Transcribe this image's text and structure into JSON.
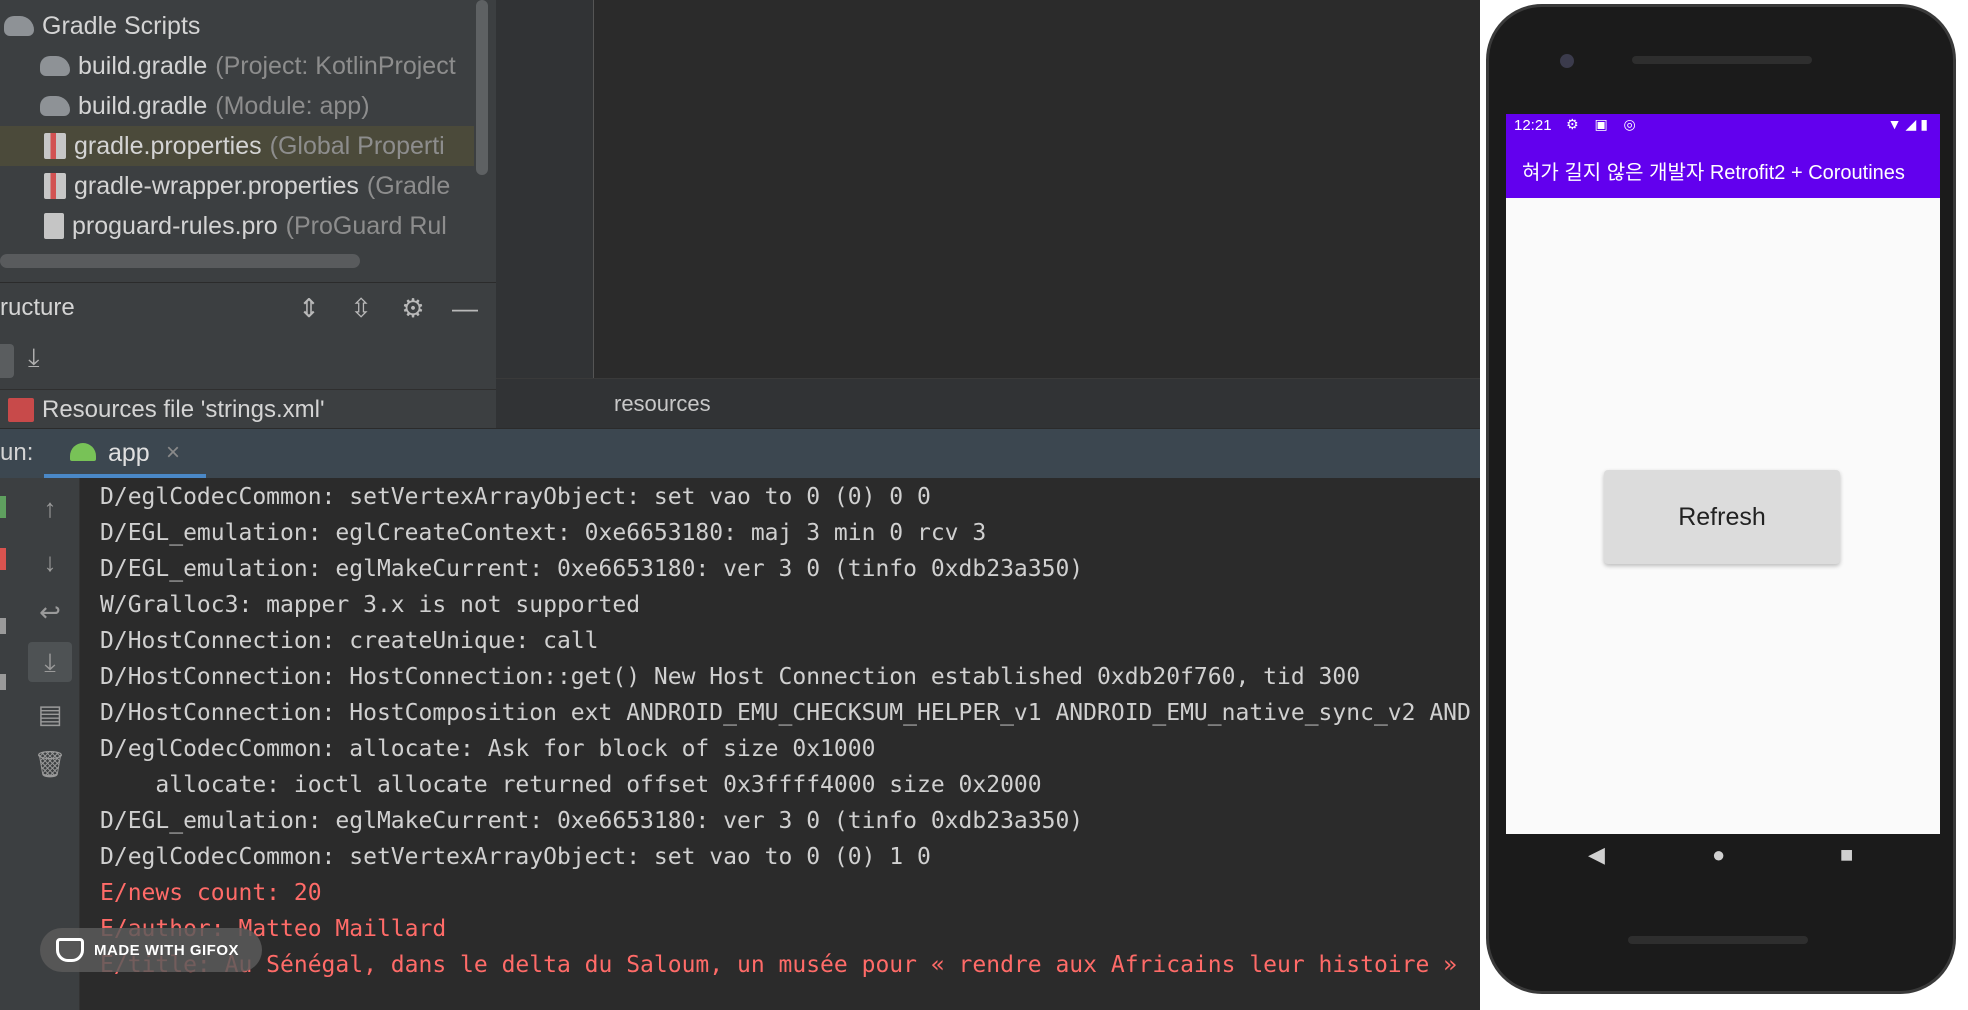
{
  "project_tree": {
    "items": [
      {
        "label": "Gradle Scripts",
        "hint": ""
      },
      {
        "label": "build.gradle",
        "hint": "(Project: KotlinProject"
      },
      {
        "label": "build.gradle",
        "hint": "(Module: app)"
      },
      {
        "label": "gradle.properties",
        "hint": "(Global Properti"
      },
      {
        "label": "gradle-wrapper.properties",
        "hint": "(Gradle"
      },
      {
        "label": "proguard-rules.pro",
        "hint": "(ProGuard Rul"
      }
    ]
  },
  "structure": {
    "title": "ructure",
    "item_label": "Resources file 'strings.xml'"
  },
  "editor": {
    "breadcrumb": "resources"
  },
  "run": {
    "label": "un:",
    "tab_label": "app",
    "close_glyph": "×"
  },
  "console": {
    "lines": [
      {
        "text": "D/eglCodecCommon: setVertexArrayObject: set vao to 0 (0) 0 0",
        "level": "debug"
      },
      {
        "text": "D/EGL_emulation: eglCreateContext: 0xe6653180: maj 3 min 0 rcv 3",
        "level": "debug"
      },
      {
        "text": "D/EGL_emulation: eglMakeCurrent: 0xe6653180: ver 3 0 (tinfo 0xdb23a350)",
        "level": "debug"
      },
      {
        "text": "W/Gralloc3: mapper 3.x is not supported",
        "level": "warn"
      },
      {
        "text": "D/HostConnection: createUnique: call",
        "level": "debug"
      },
      {
        "text": "D/HostConnection: HostConnection::get() New Host Connection established 0xdb20f760, tid 300",
        "level": "debug"
      },
      {
        "text": "D/HostConnection: HostComposition ext ANDROID_EMU_CHECKSUM_HELPER_v1 ANDROID_EMU_native_sync_v2 AND",
        "level": "debug"
      },
      {
        "text": "D/eglCodecCommon: allocate: Ask for block of size 0x1000",
        "level": "debug"
      },
      {
        "text": "    allocate: ioctl allocate returned offset 0x3ffff4000 size 0x2000",
        "level": "debug"
      },
      {
        "text": "D/EGL_emulation: eglMakeCurrent: 0xe6653180: ver 3 0 (tinfo 0xdb23a350)",
        "level": "debug"
      },
      {
        "text": "D/eglCodecCommon: setVertexArrayObject: set vao to 0 (0) 1 0",
        "level": "debug"
      },
      {
        "text": "E/news count: 20",
        "level": "error"
      },
      {
        "text": "E/author: Matteo Maillard",
        "level": "error"
      },
      {
        "text": "E/title: Au Sénégal, dans le delta du Saloum, un musée pour « rendre aux Africains leur histoire »",
        "level": "error"
      }
    ],
    "toolbar_icons": [
      "up-arrow-icon",
      "down-arrow-icon",
      "soft-wrap-icon",
      "scroll-to-end-icon",
      "print-icon",
      "trash-icon"
    ]
  },
  "badge": {
    "label": "MADE WITH GIFOX"
  },
  "phone": {
    "status_time": "12:21",
    "status_icons_left": "⚙ ▣ ◎",
    "status_icons_right": "▼◢▮",
    "app_title": "혀가 길지 않은 개발자 Retrofit2 + Coroutines",
    "refresh_label": "Refresh",
    "nav_back": "◀",
    "nav_home": "●",
    "nav_recents": "■",
    "accent_color": "#6200ee"
  }
}
